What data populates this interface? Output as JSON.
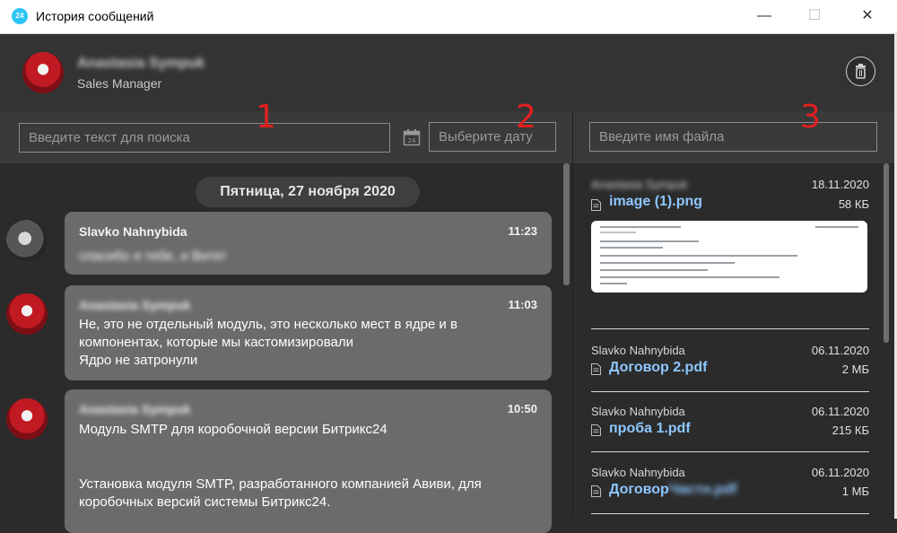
{
  "window": {
    "app_icon_text": "24",
    "title": "История сообщений",
    "minimize": "—",
    "maximize": "☐",
    "close": "✕"
  },
  "header": {
    "contact_name": "Anastasia Sympuk",
    "contact_role": "Sales Manager",
    "trash_icon": "trash-icon"
  },
  "search": {
    "text_placeholder": "Введите текст для поиска",
    "date_placeholder": "Выберите дату",
    "file_placeholder": "Введите имя файла",
    "calendar_icon_text": "24"
  },
  "annotations": [
    "1",
    "2",
    "3"
  ],
  "chat": {
    "date_separator": "Пятница, 27 ноября 2020",
    "messages": [
      {
        "author": "Slavko Nahnybida",
        "time": "11:23",
        "lines": [
          "спасибо и тебе, и Вите!"
        ]
      },
      {
        "author": "Anastasia Sympuk",
        "time": "11:03",
        "lines": [
          "Не, это не отдельный модуль, это несколько мест в ядре и в",
          "компонентах, которые мы кастомизировали",
          "Ядро не затронули"
        ]
      },
      {
        "author": "Anastasia Sympuk",
        "time": "10:50",
        "lines": [
          "Модуль SMTP для коробочной версии Битрикс24",
          "",
          "Установка модуля SMTP, разработанного компанией Авиви, для",
          "коробочных версий системы Битрикс24."
        ]
      }
    ]
  },
  "files": [
    {
      "author": "Anastasia Sympuk",
      "date": "18.11.2020",
      "name": "image (1).png",
      "size": "58 КБ"
    },
    {
      "author": "Slavko Nahnybida",
      "date": "06.11.2020",
      "name": "Договор 2.pdf",
      "size": "2 МБ"
    },
    {
      "author": "Slavko Nahnybida",
      "date": "06.11.2020",
      "name": "проба 1.pdf",
      "size": "215 КБ"
    },
    {
      "author": "Slavko Nahnybida",
      "date": "06.11.2020",
      "name": "Договор",
      "name_blurred": "Частн.pdf",
      "size": "1 МБ"
    }
  ],
  "colors": {
    "bubble": "#6b6b6b",
    "link": "#8ec7ff",
    "annotation": "#e02020",
    "background": "#2b2b2b"
  }
}
